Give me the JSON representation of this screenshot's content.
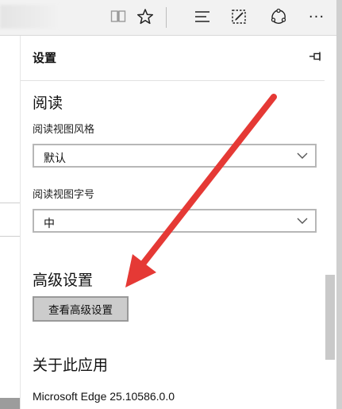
{
  "toolbar": {
    "icons": [
      "reading-view-icon",
      "favorite-star-icon",
      "hub-icon",
      "web-note-icon",
      "share-icon",
      "more-icon"
    ],
    "more_label": "···"
  },
  "settings": {
    "title": "设置",
    "reading": {
      "heading": "阅读",
      "style_label": "阅读视图风格",
      "style_value": "默认",
      "font_label": "阅读视图字号",
      "font_value": "中"
    },
    "advanced": {
      "heading": "高级设置",
      "button_label": "查看高级设置"
    },
    "about": {
      "heading": "关于此应用",
      "version": "Microsoft Edge 25.10586.0.0"
    }
  },
  "colors": {
    "annotation_arrow": "#e53935"
  }
}
